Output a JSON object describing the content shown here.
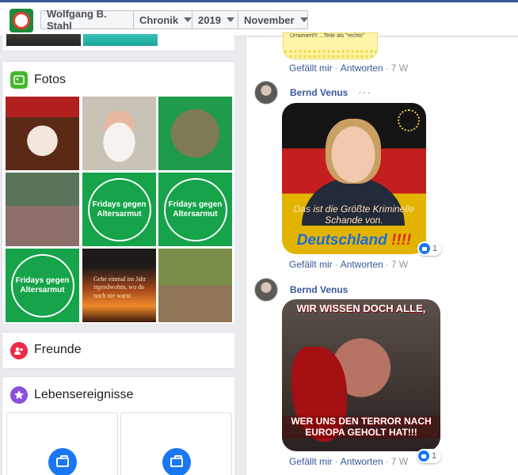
{
  "breadcrumb": {
    "profile_name": "Wolfgang B. Stahl",
    "section": "Chronik",
    "year": "2019",
    "month": "November"
  },
  "left": {
    "fotos_title": "Fotos",
    "freunde_title": "Freunde",
    "lebensereignisse_title": "Lebensereignisse",
    "photo_texts": {
      "fridays1": "Fridays gegen Altersarmut",
      "fridays2": "Fridays gegen Altersarmut",
      "fridays3": "Fridays gegen Altersarmut",
      "sunset": "Gehe einmal im Jahr irgendwohin, wo du noch nie warst."
    }
  },
  "comments": [
    {
      "image_text": "Urramiert!!!",
      "image_text2": "...Teile als \"rechts\"",
      "like_label": "Gefällt mir",
      "reply_label": "Antworten",
      "time": "7 W"
    },
    {
      "author": "Bernd Venus",
      "more": "···",
      "image_caption_small": "Das ist die Größte Kriminelle Schande von.",
      "image_caption_big": "Deutschland",
      "image_caption_excl": "!!!!",
      "reaction_count": "1",
      "like_label": "Gefällt mir",
      "reply_label": "Antworten",
      "time": "7 W"
    },
    {
      "author": "Bernd Venus",
      "image_caption_top": "WIR WISSEN DOCH ALLE,",
      "image_caption_bottom": "WER UNS DEN TERROR NACH EUROPA GEHOLT HAT!!!",
      "reaction_count": "1",
      "like_label": "Gefällt mir",
      "reply_label": "Antworten",
      "time": "7 W"
    }
  ],
  "separator": "·",
  "colors": {
    "brand": "#3b5998",
    "link": "#385898",
    "meta": "#90949c",
    "fotos_icon": "#42b72a",
    "freunde_icon": "#f02849",
    "leben_icon": "#8a4fdd"
  }
}
